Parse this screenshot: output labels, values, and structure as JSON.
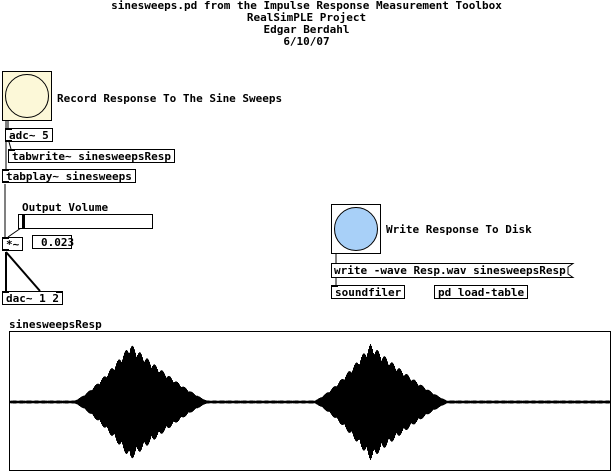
{
  "header": {
    "line1": "sinesweeps.pd from the Impulse Response Measurement Toolbox",
    "line2": "RealSimPLE Project",
    "line3": "Edgar Berdahl",
    "line4": "6/10/07"
  },
  "record": {
    "label": "Record Response To The Sine Sweeps",
    "bang_color": "#fcf8d8"
  },
  "objects": {
    "adc": "adc~ 5",
    "tabwrite": "tabwrite~ sinesweepsResp",
    "tabplay": "tabplay~ sinesweeps",
    "mult": "*~",
    "dac": "dac~ 1 2",
    "soundfiler": "soundfiler",
    "load_table": "pd load-table"
  },
  "volume": {
    "label": "Output Volume",
    "value": "0.023",
    "slider_fraction": 0.023
  },
  "write": {
    "label": "Write Response To Disk",
    "message": "write -wave Resp.wav sinesweepsResp",
    "bang_color": "#a8d0f8"
  },
  "array": {
    "name": "sinesweepsResp"
  }
}
